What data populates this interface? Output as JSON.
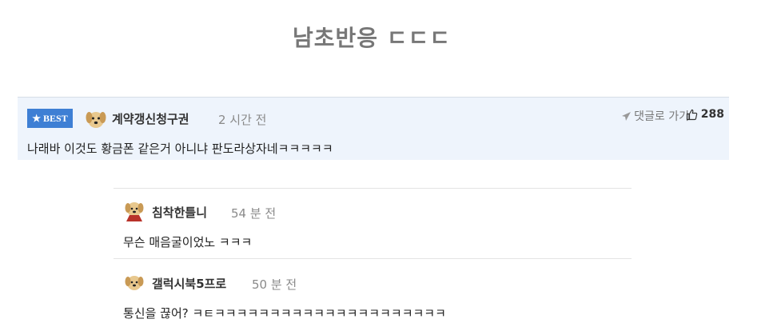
{
  "headline": "남초반응 ㄷㄷㄷ",
  "best": {
    "badge_label": "BEST",
    "username": "계약갱신청구권",
    "time": "2 시간 전",
    "reply_label": "댓글로 가기",
    "likes": "288",
    "text": "나래바 이것도 황금폰 같은거 아니냐 판도라상자네ㅋㅋㅋㅋㅋ"
  },
  "replies": [
    {
      "username": "침착한틀니",
      "time": "54 분 전",
      "text": "무슨 매음굴이었노 ㅋㅋㅋ"
    },
    {
      "username": "갤럭시북5프로",
      "time": "50 분 전",
      "text": "통신을 끊어? ㅋㅌㅋㅋㅋㅋㅋㅋㅋㅋㅋㅋㅋㅋㅋㅋㅋㅋㅋㅋㅋㅋㅋ"
    }
  ],
  "icons": {
    "badge": "star-icon",
    "avatar": "dog-avatar-icon",
    "reply": "paper-plane-icon",
    "like": "thumbs-up-icon"
  },
  "colors": {
    "badge_bg": "#3e7fd4",
    "best_bg": "#eef4fc",
    "headline": "#777777"
  }
}
